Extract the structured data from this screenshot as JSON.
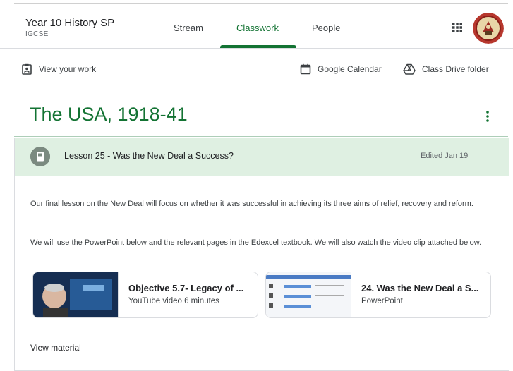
{
  "header": {
    "class_name": "Year 10 History SP",
    "class_section": "IGCSE",
    "tabs": [
      {
        "label": "Stream"
      },
      {
        "label": "Classwork",
        "active": true
      },
      {
        "label": "People"
      }
    ],
    "icons": [
      "apps-grid-icon",
      "avatar"
    ]
  },
  "toolbar": {
    "view_work": "View your work",
    "google_calendar": "Google Calendar",
    "class_drive": "Class Drive folder"
  },
  "topic": {
    "title": "The USA, 1918-41"
  },
  "assignment": {
    "title": "Lesson 25 - Was the New Deal a Success?",
    "edited": "Edited Jan 19",
    "description": [
      "Our final lesson on the New Deal will focus on whether it was successful in achieving its three aims of relief, recovery and reform.",
      "We will use the PowerPoint below and the relevant pages in the Edexcel textbook.  We will also watch the video clip attached below."
    ],
    "attachments": [
      {
        "title": "Objective 5.7- Legacy of ...",
        "subtitle": "YouTube video  6 minutes"
      },
      {
        "title": "24. Was the New Deal a S...",
        "subtitle": "PowerPoint"
      }
    ],
    "view_material": "View material"
  },
  "colors": {
    "accent": "#137333",
    "card_header": "#dff0e2"
  }
}
